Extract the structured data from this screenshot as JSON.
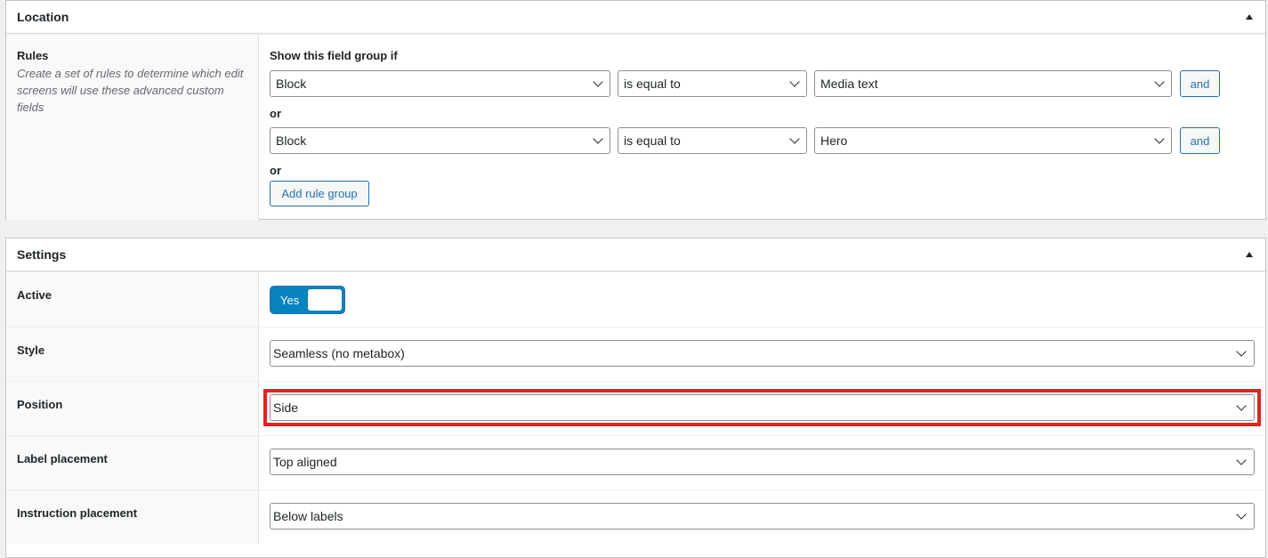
{
  "location": {
    "title": "Location",
    "rules_label": "Rules",
    "rules_desc": "Create a set of rules to determine which edit screens will use these advanced custom fields",
    "group_title": "Show this field group if",
    "groups": [
      {
        "param": "Block",
        "operator": "is equal to",
        "value": "Media text",
        "and_label": "and"
      },
      {
        "param": "Block",
        "operator": "is equal to",
        "value": "Hero",
        "and_label": "and"
      }
    ],
    "or_label": "or",
    "add_group_label": "Add rule group"
  },
  "settings": {
    "title": "Settings",
    "active": {
      "label": "Active",
      "value": "Yes",
      "on": true
    },
    "style": {
      "label": "Style",
      "value": "Seamless (no metabox)"
    },
    "position": {
      "label": "Position",
      "value": "Side"
    },
    "label_placement": {
      "label": "Label placement",
      "value": "Top aligned"
    },
    "instruction_placement": {
      "label": "Instruction placement",
      "value": "Below labels"
    }
  },
  "colors": {
    "accent": "#2271b1",
    "toggle": "#0783be",
    "highlight": "#e32222"
  }
}
